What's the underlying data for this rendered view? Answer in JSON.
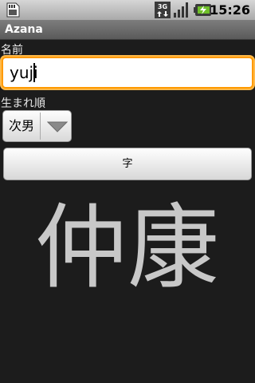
{
  "status_bar": {
    "time": "15:26",
    "icons": [
      "sd-card-icon",
      "3g-data-icon",
      "signal-icon",
      "battery-charging-icon"
    ],
    "network_label": "3G"
  },
  "app": {
    "title": "Azana"
  },
  "form": {
    "name_label": "名前",
    "name_value": "yuji",
    "birth_order_label": "生まれ順",
    "birth_order_value": "次男",
    "button_label": "字"
  },
  "result": {
    "kanji": "仲康"
  },
  "colors": {
    "focus": "#ff9a00",
    "background": "#1c1c1c",
    "result_text": "#c8c8c8"
  }
}
